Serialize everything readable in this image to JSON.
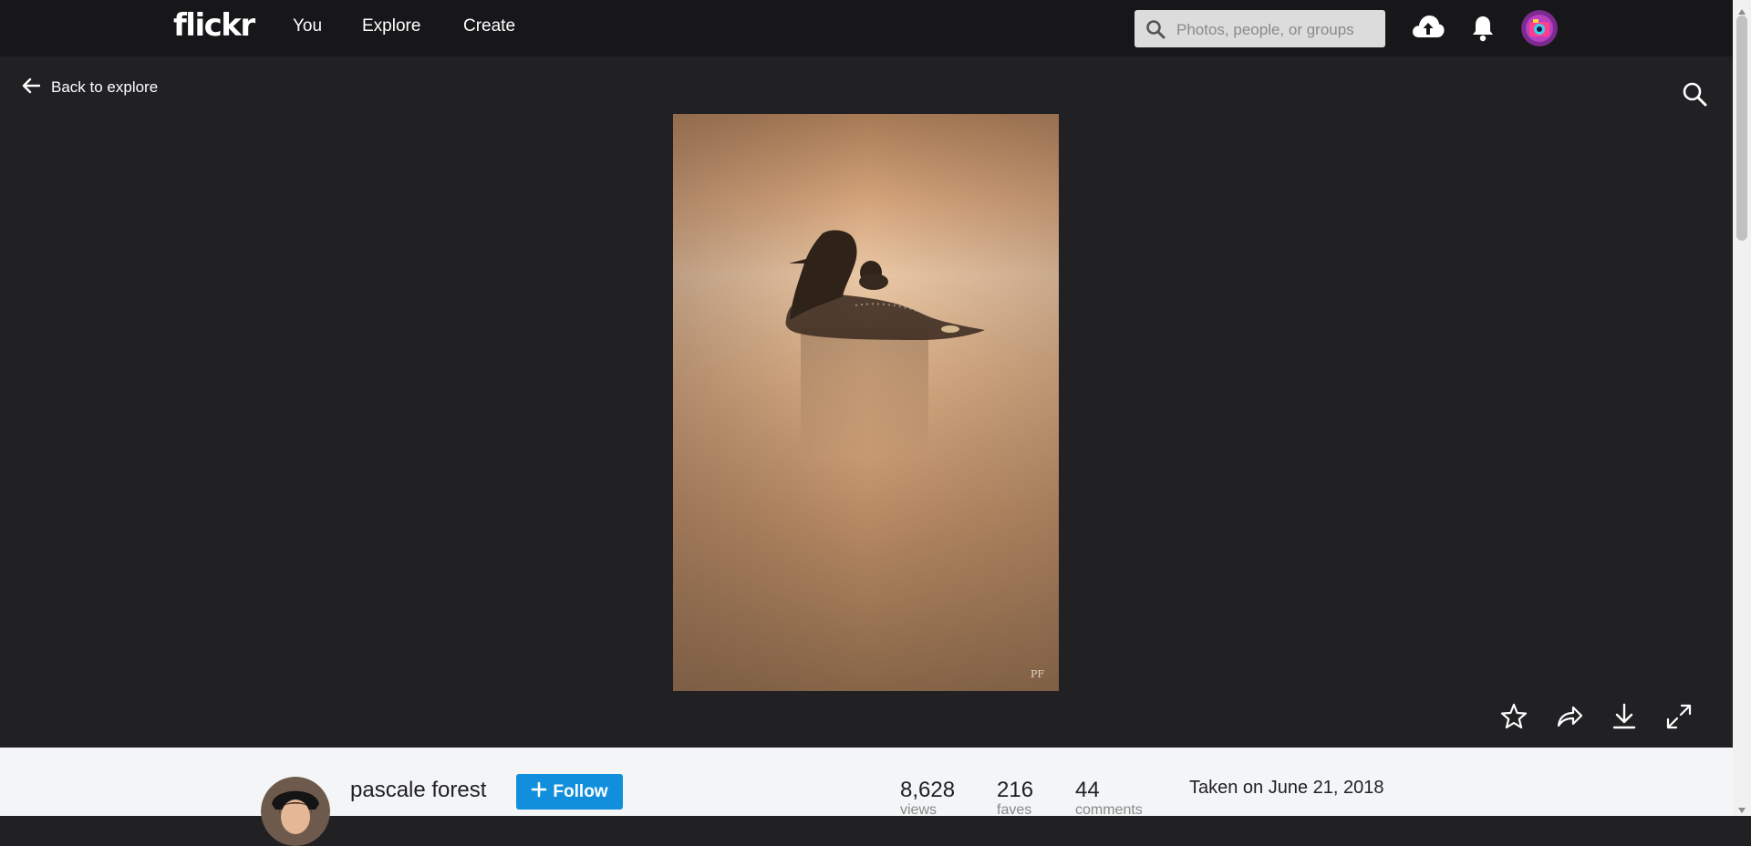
{
  "nav": {
    "logo": "flickr",
    "links": [
      "You",
      "Explore",
      "Create"
    ],
    "search_placeholder": "Photos, people, or groups",
    "icons": [
      "upload-icon",
      "notifications-bell-icon",
      "user-avatar"
    ]
  },
  "photo_view": {
    "back_label": "Back to explore",
    "actions": [
      "favorite-star-icon",
      "share-icon",
      "download-icon",
      "fullscreen-icon"
    ]
  },
  "owner": {
    "name": "pascale forest",
    "follow_label": "Follow"
  },
  "stats": {
    "views_count": "8,628",
    "views_label": "views",
    "faves_count": "216",
    "faves_label": "faves",
    "comments_count": "44",
    "comments_label": "comments"
  },
  "taken": "Taken on June 21, 2018",
  "colors": {
    "nav_bg": "#17171a",
    "viewer_bg": "#212124",
    "follow_blue": "#128fdc",
    "info_bg": "#f3f5f6"
  }
}
